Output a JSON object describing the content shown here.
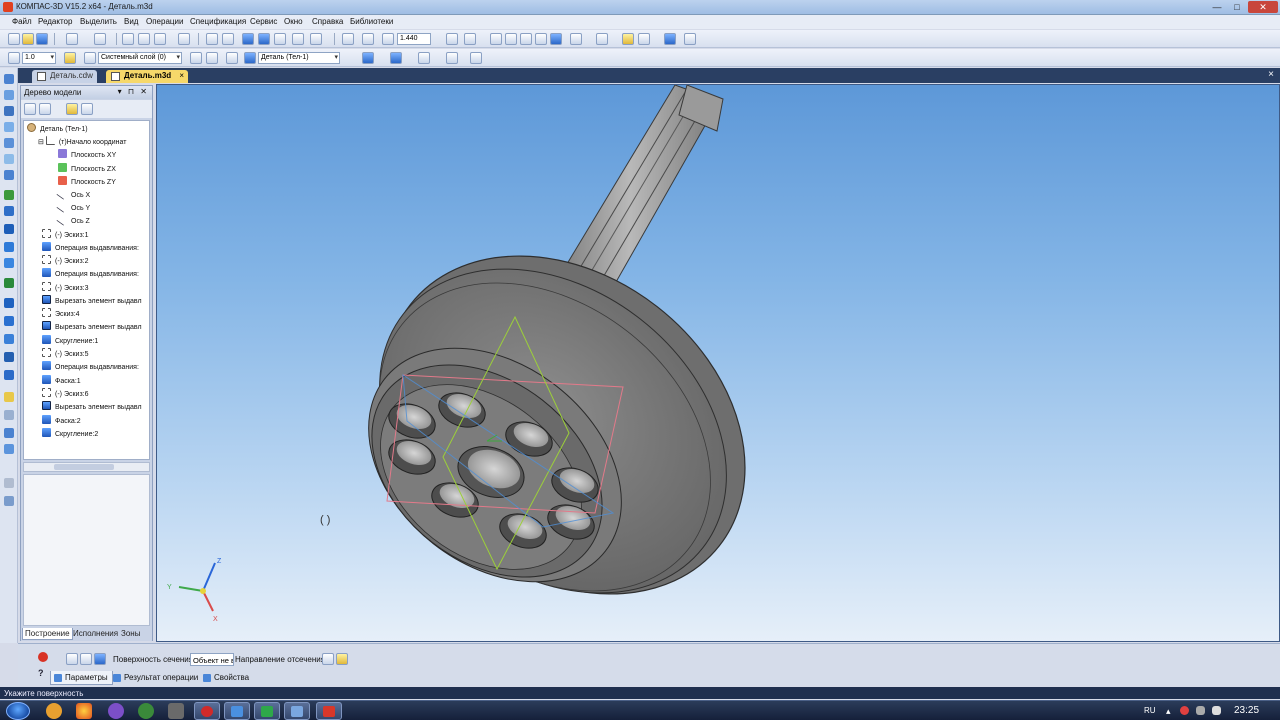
{
  "window": {
    "title": "КОМПАС-3D V15.2  x64 - Деталь.m3d",
    "min": "—",
    "max": "□",
    "close": "✕"
  },
  "menu": [
    "Файл",
    "Редактор",
    "Выделить",
    "Вид",
    "Операции",
    "Спецификация",
    "Сервис",
    "Окно",
    "Справка",
    "Библиотеки"
  ],
  "toolbar": {
    "zoom_value": "1.440",
    "step_value": "1.0",
    "layer_value": "Системный слой (0)",
    "part_value": "Деталь (Тел-1)"
  },
  "tabs": [
    {
      "label": "Деталь.cdw",
      "active": false
    },
    {
      "label": "Деталь.m3d",
      "active": true,
      "close": "×"
    }
  ],
  "tree": {
    "header": "Дерево модели",
    "header_buttons": "▾ ⊓ ✕",
    "items": [
      {
        "label": "Деталь (Тел-1)",
        "icon": "part-icon"
      },
      {
        "label": "(т)Начало координат",
        "icon": "origin-icon"
      },
      {
        "label": "Плоскость XY",
        "icon": "plane-xy-icon"
      },
      {
        "label": "Плоскость ZX",
        "icon": "plane-zx-icon"
      },
      {
        "label": "Плоскость ZY",
        "icon": "plane-zy-icon"
      },
      {
        "label": "Ось X",
        "icon": "axis-icon"
      },
      {
        "label": "Ось Y",
        "icon": "axis-icon"
      },
      {
        "label": "Ось Z",
        "icon": "axis-icon"
      },
      {
        "label": "(-) Эскиз:1",
        "icon": "sketch-icon"
      },
      {
        "label": "Операция выдавливания:",
        "icon": "extrude-icon"
      },
      {
        "label": "(-) Эскиз:2",
        "icon": "sketch-icon"
      },
      {
        "label": "Операция выдавливания:",
        "icon": "extrude-icon"
      },
      {
        "label": "(-) Эскиз:3",
        "icon": "sketch-icon"
      },
      {
        "label": "Вырезать элемент выдавл",
        "icon": "cut-icon"
      },
      {
        "label": "Эскиз:4",
        "icon": "sketch-icon"
      },
      {
        "label": "Вырезать элемент выдавл",
        "icon": "cut-icon"
      },
      {
        "label": "Скругление:1",
        "icon": "fillet-icon"
      },
      {
        "label": "(-) Эскиз:5",
        "icon": "sketch-icon"
      },
      {
        "label": "Операция выдавливания:",
        "icon": "extrude-icon"
      },
      {
        "label": "Фаска:1",
        "icon": "chamfer-icon"
      },
      {
        "label": "(-) Эскиз:6",
        "icon": "sketch-icon"
      },
      {
        "label": "Вырезать элемент выдавл",
        "icon": "cut-icon"
      },
      {
        "label": "Фаска:2",
        "icon": "chamfer-icon"
      },
      {
        "label": "Скругление:2",
        "icon": "fillet-icon"
      }
    ],
    "bottom_tabs": [
      "Построение",
      "Исполнения",
      "Зоны"
    ]
  },
  "viewport": {
    "axis_z": "Z",
    "axis_x": "X",
    "axis_y": "Y",
    "colors": {
      "bg_top": "#5d98d8",
      "bg_bottom": "#e6eff9",
      "part": "#8c8c8c"
    }
  },
  "properties": {
    "surface_label": "Поверхность сечения",
    "surface_value": "Объект не выбран",
    "direction_label": "Направление отсечения",
    "tabs": [
      "Параметры",
      "Результат операции",
      "Свойства"
    ]
  },
  "status": {
    "message": "Укажите поверхность"
  },
  "taskbar": {
    "lang": "RU",
    "time": "23:25"
  }
}
